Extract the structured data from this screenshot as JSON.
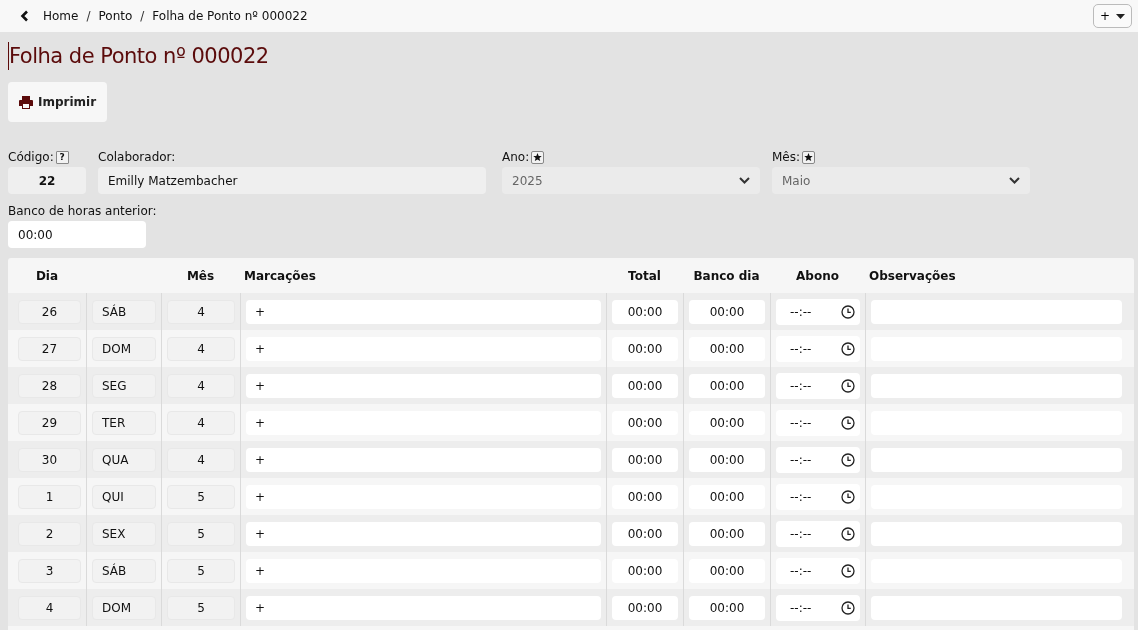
{
  "breadcrumb": [
    "Home",
    "Ponto",
    "Folha de Ponto nº 000022"
  ],
  "breadcrumb_separators": [
    "/",
    "/"
  ],
  "add_menu": {
    "label": "+"
  },
  "title": "Folha de Ponto nº 000022",
  "print_button": "Imprimir",
  "form": {
    "codigo": {
      "label": "Código:",
      "help": "?",
      "value": "22"
    },
    "colaborador": {
      "label": "Colaborador:",
      "value": "Emilly Matzembacher"
    },
    "ano": {
      "label": "Ano:",
      "value": "2025"
    },
    "mes": {
      "label": "Mês:",
      "value": "Maio"
    },
    "banco_anterior": {
      "label": "Banco de horas anterior:",
      "value": "00:00"
    }
  },
  "table": {
    "columns": [
      "Dia",
      "Mês",
      "Marcações",
      "Total",
      "Banco dia",
      "Abono",
      "Observações"
    ],
    "rows": [
      {
        "dia": "26",
        "weekday": "SÁB",
        "mes": "4",
        "marcacoes": "+",
        "total": "00:00",
        "banco_dia": "00:00",
        "abono": "--:--"
      },
      {
        "dia": "27",
        "weekday": "DOM",
        "mes": "4",
        "marcacoes": "+",
        "total": "00:00",
        "banco_dia": "00:00",
        "abono": "--:--"
      },
      {
        "dia": "28",
        "weekday": "SEG",
        "mes": "4",
        "marcacoes": "+",
        "total": "00:00",
        "banco_dia": "00:00",
        "abono": "--:--"
      },
      {
        "dia": "29",
        "weekday": "TER",
        "mes": "4",
        "marcacoes": "+",
        "total": "00:00",
        "banco_dia": "00:00",
        "abono": "--:--"
      },
      {
        "dia": "30",
        "weekday": "QUA",
        "mes": "4",
        "marcacoes": "+",
        "total": "00:00",
        "banco_dia": "00:00",
        "abono": "--:--"
      },
      {
        "dia": "1",
        "weekday": "QUI",
        "mes": "5",
        "marcacoes": "+",
        "total": "00:00",
        "banco_dia": "00:00",
        "abono": "--:--"
      },
      {
        "dia": "2",
        "weekday": "SEX",
        "mes": "5",
        "marcacoes": "+",
        "total": "00:00",
        "banco_dia": "00:00",
        "abono": "--:--"
      },
      {
        "dia": "3",
        "weekday": "SÁB",
        "mes": "5",
        "marcacoes": "+",
        "total": "00:00",
        "banco_dia": "00:00",
        "abono": "--:--"
      },
      {
        "dia": "4",
        "weekday": "DOM",
        "mes": "5",
        "marcacoes": "+",
        "total": "00:00",
        "banco_dia": "00:00",
        "abono": "--:--"
      }
    ]
  }
}
